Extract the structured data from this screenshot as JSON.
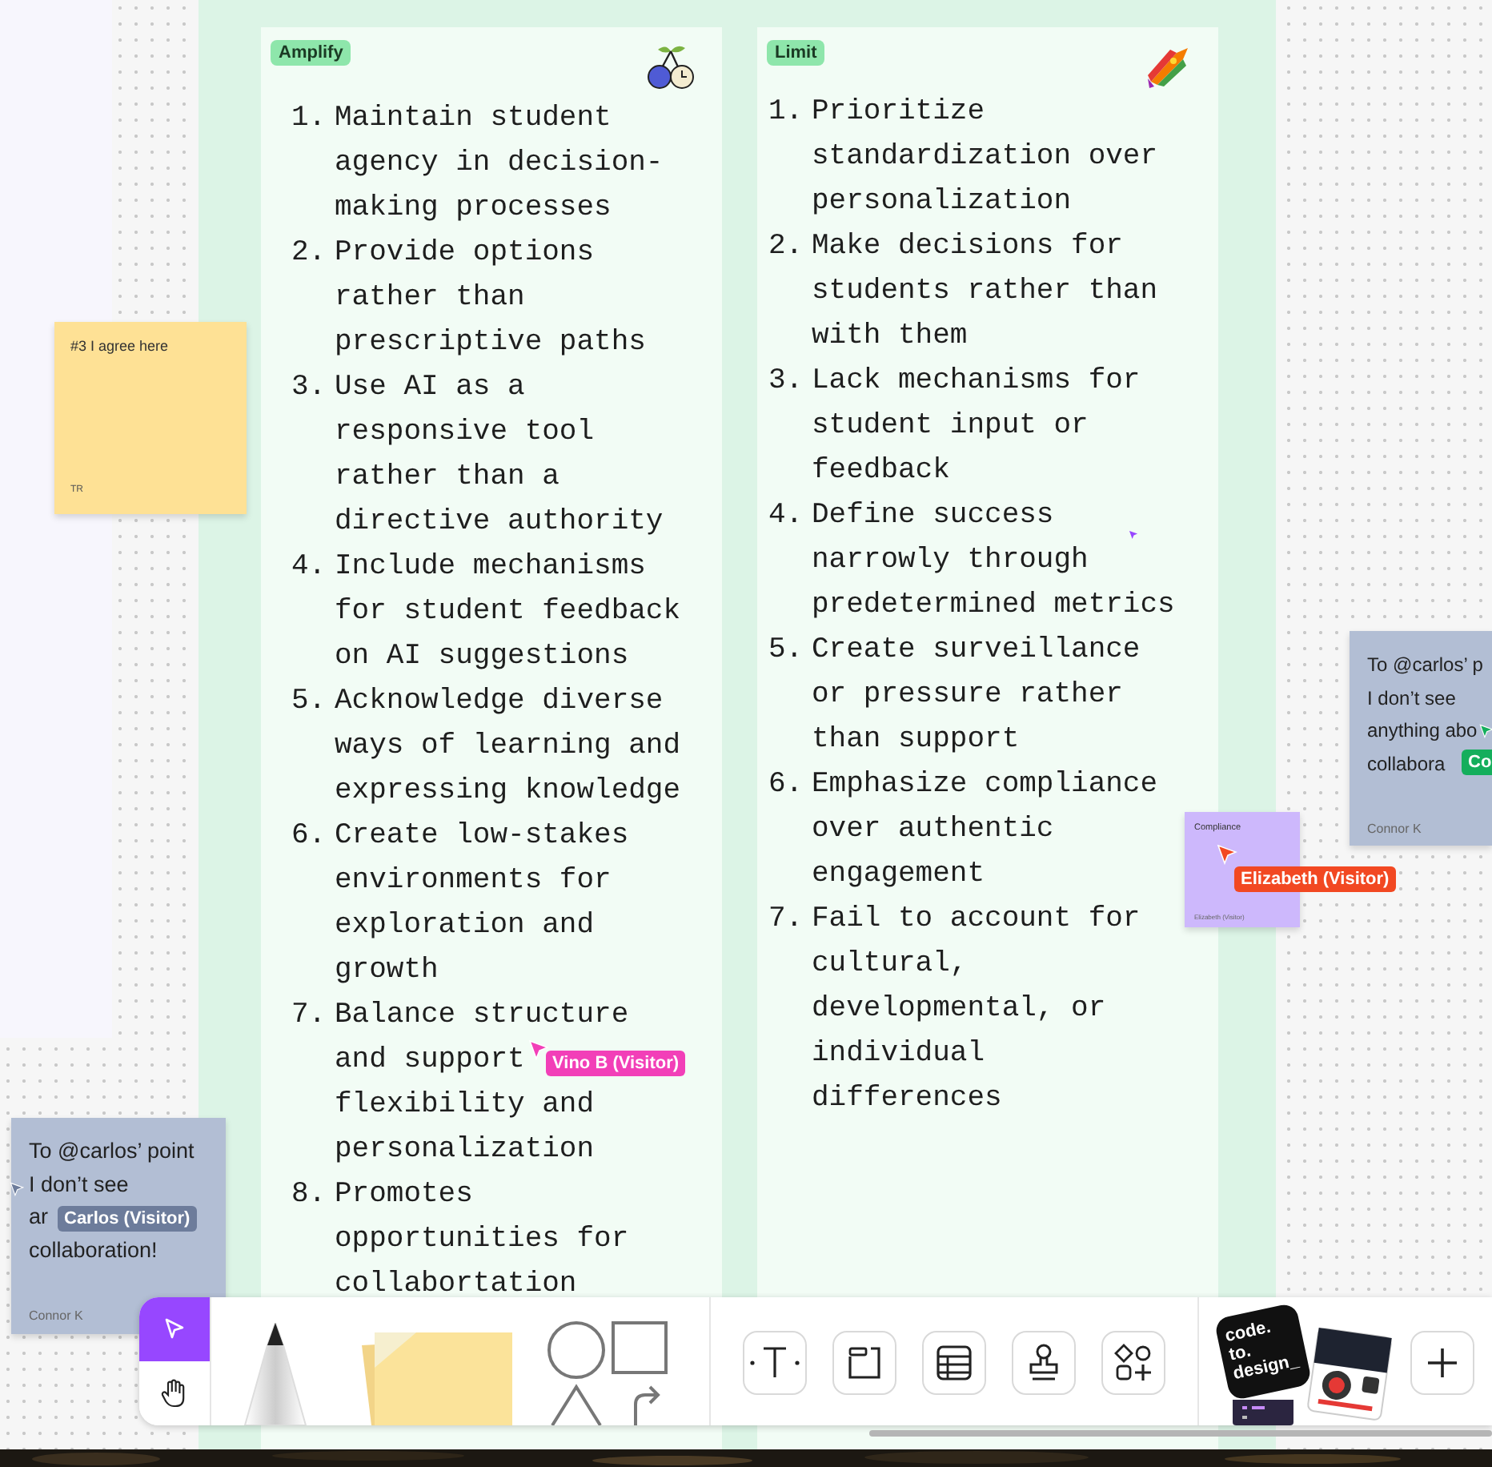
{
  "section": {
    "columns": [
      {
        "tag": "Amplify",
        "items": [
          {
            "number": "1.",
            "lines": [
              "Maintain student",
              "agency in decision-",
              "making processes"
            ]
          },
          {
            "number": "2.",
            "lines": [
              "Provide options",
              "rather than",
              "prescriptive paths"
            ]
          },
          {
            "number": "3.",
            "lines": [
              "Use AI as a",
              "responsive tool",
              "rather than a",
              "directive authority"
            ]
          },
          {
            "number": "4.",
            "lines": [
              "Include mechanisms",
              "for student feedback",
              "on AI suggestions"
            ]
          },
          {
            "number": "5.",
            "lines": [
              "Acknowledge diverse",
              "ways of learning and",
              "expressing knowledge"
            ]
          },
          {
            "number": "6.",
            "lines": [
              "Create low-stakes",
              "environments for",
              "exploration and",
              "growth"
            ]
          },
          {
            "number": "7.",
            "lines": [
              "Balance structure",
              "and support",
              "flexibility and",
              "personalization"
            ]
          },
          {
            "number": "8.",
            "lines": [
              "Promotes",
              "opportunities for",
              "collabortation"
            ]
          }
        ]
      },
      {
        "tag": "Limit",
        "items": [
          {
            "number": "1.",
            "lines": [
              "Prioritize",
              "standardization over",
              "personalization"
            ]
          },
          {
            "number": "2.",
            "lines": [
              "Make decisions for",
              "students rather than",
              "with them"
            ]
          },
          {
            "number": "3.",
            "lines": [
              "Lack mechanisms for",
              "student input or",
              "feedback"
            ]
          },
          {
            "number": "4.",
            "lines": [
              "Define success",
              "narrowly through",
              "predetermined metrics"
            ]
          },
          {
            "number": "5.",
            "lines": [
              "Create surveillance",
              "or pressure rather",
              "than support"
            ]
          },
          {
            "number": "6.",
            "lines": [
              "Emphasize compliance",
              "over authentic",
              "engagement"
            ]
          },
          {
            "number": "7.",
            "lines": [
              "Fail to account for",
              "cultural,",
              "developmental, or",
              "individual",
              "differences"
            ]
          }
        ]
      }
    ]
  },
  "stickies": [
    {
      "color": "#fee195",
      "lines": [
        "#3 I agree here"
      ],
      "author": "TR"
    },
    {
      "color": "#cdb8fc",
      "lines": [
        "Compliance"
      ],
      "author": "Elizabeth (Visitor)"
    },
    {
      "color": "#b2bed4",
      "lines": [
        "To @carlos’ p",
        "I don’t see",
        "anything abo",
        "collabora"
      ],
      "author": "Connor K"
    },
    {
      "color": "#b2bed4",
      "lines": [
        "To @carlos’ point",
        "I don’t see",
        "ar",
        "collaboration!"
      ],
      "author": "Connor K"
    }
  ],
  "cursors": [
    {
      "name": "Vino B (Visitor)",
      "color": "#f23fb8"
    },
    {
      "name": "Elizabeth (Visitor)",
      "color": "#f24822"
    },
    {
      "name": "Carlos (Visitor)",
      "color": "#6d7c9b"
    },
    {
      "name": "Co",
      "color": "#14ae5c"
    }
  ],
  "toolbar": {
    "tools": [
      {
        "kind": "select",
        "selected": true
      },
      {
        "kind": "hand",
        "selected": false
      }
    ],
    "plugin_text": "code. to. design_"
  }
}
